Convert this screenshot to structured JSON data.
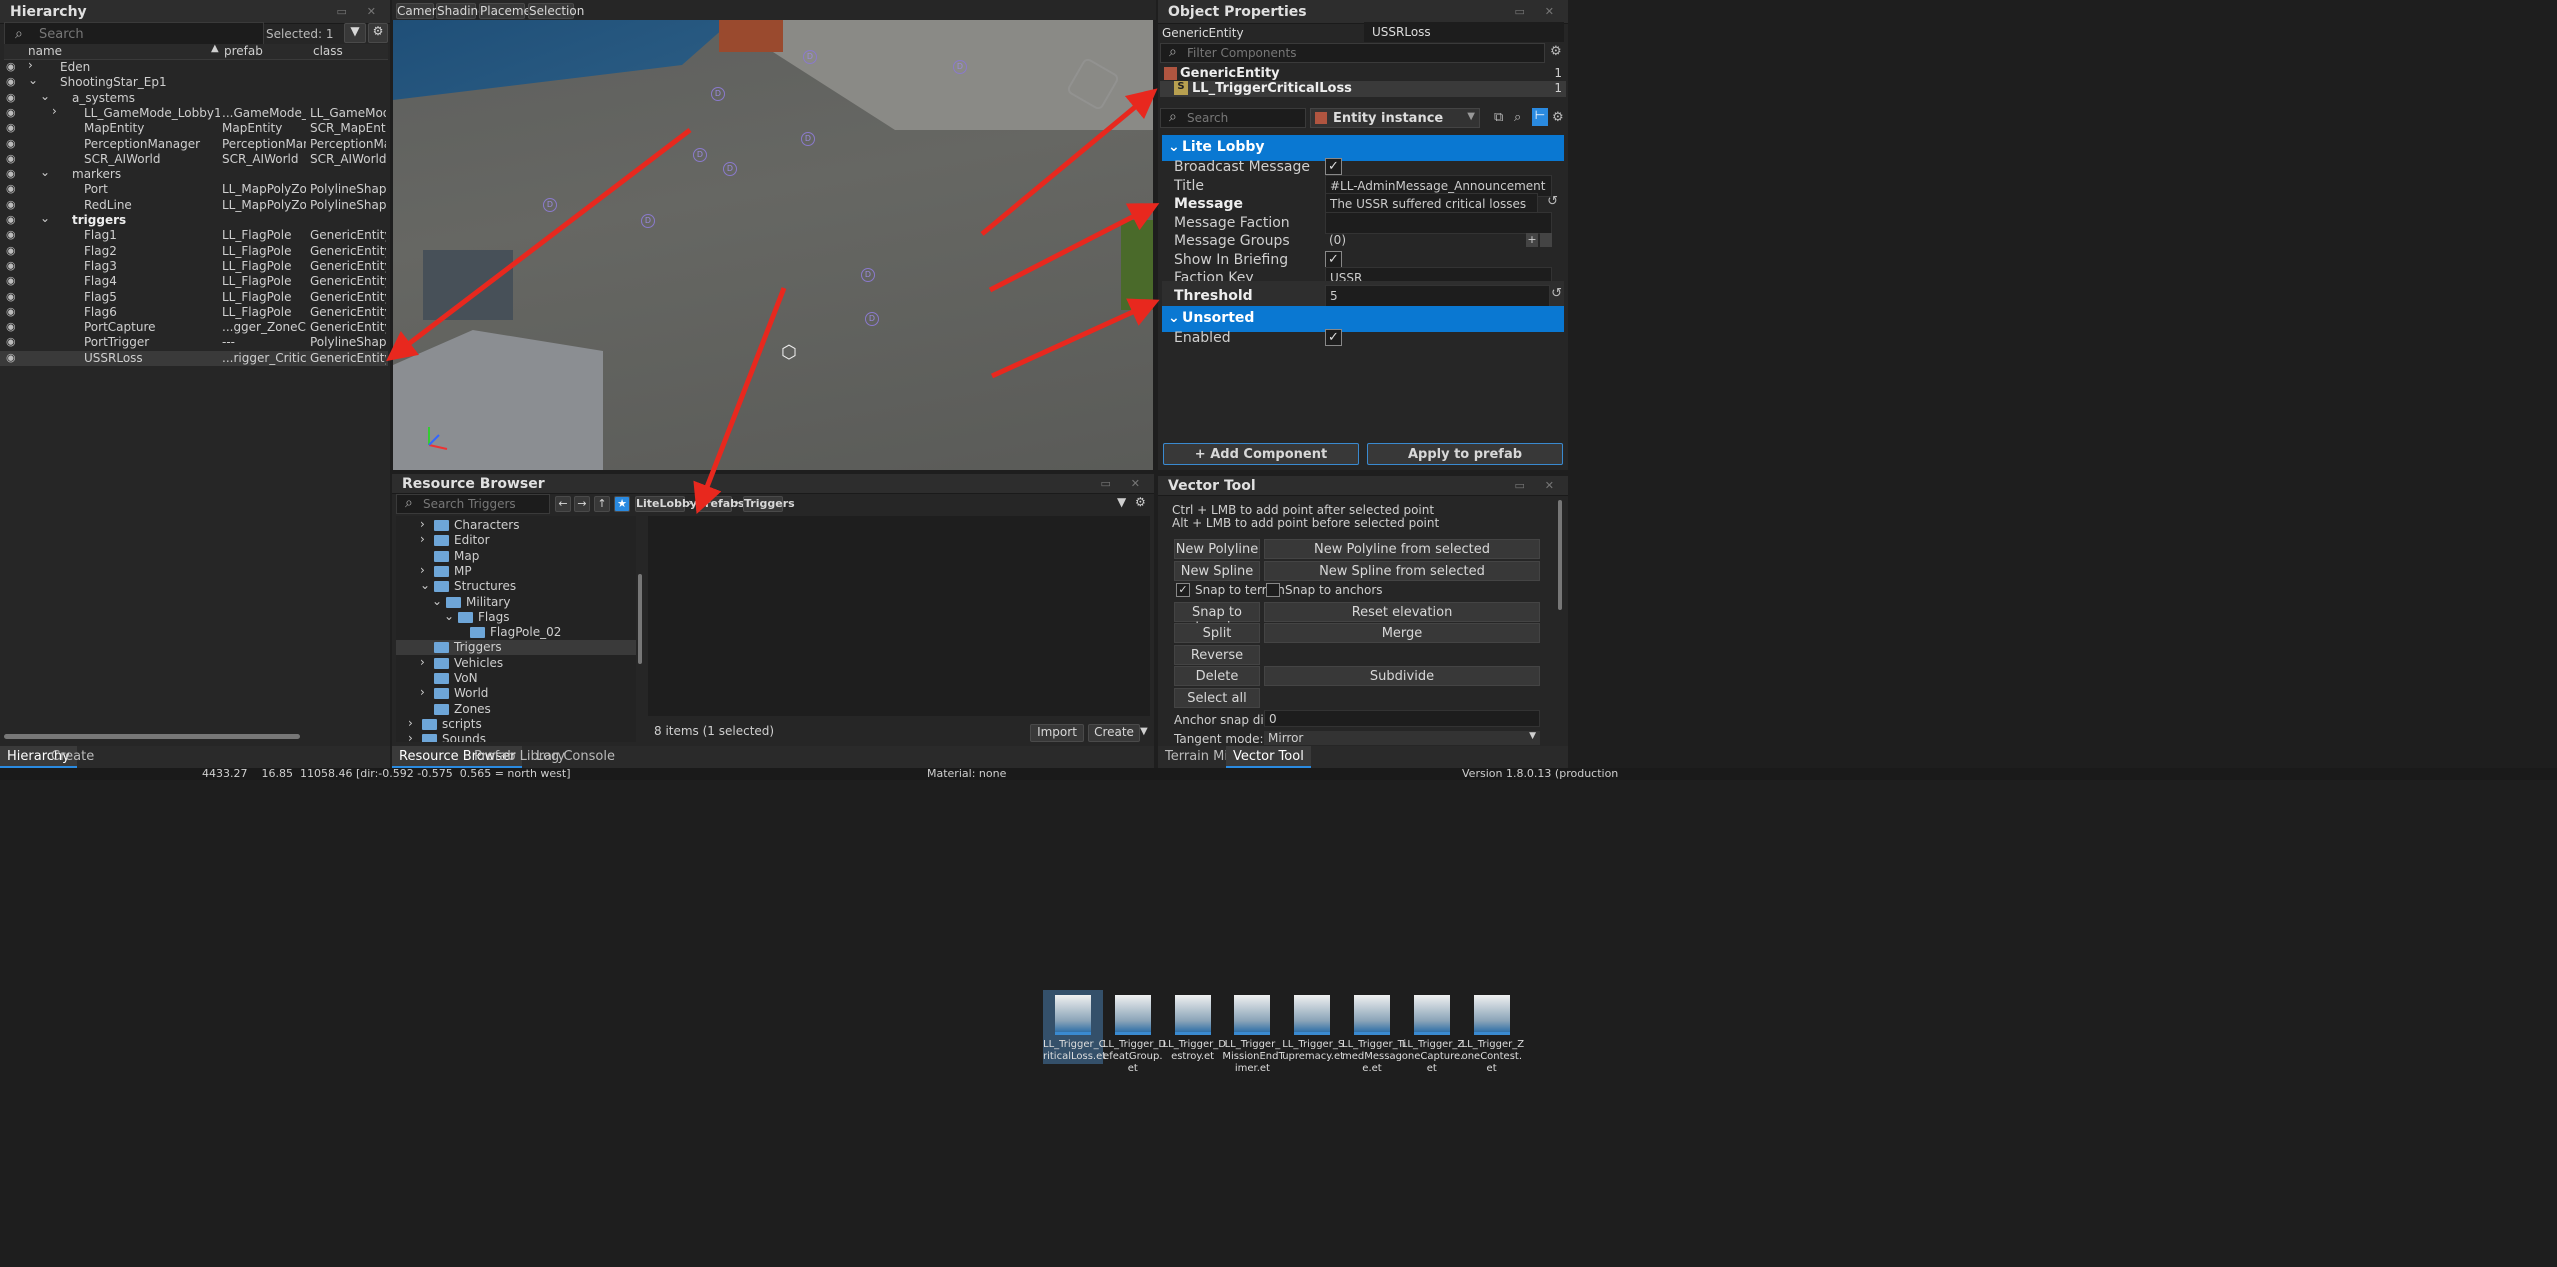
{
  "hierarchy": {
    "title": "Hierarchy",
    "search_placeholder": "Search",
    "selected": "Selected: 1",
    "columns": [
      "name",
      "prefab",
      "class"
    ],
    "rows": [
      {
        "name": "Eden",
        "prefab": "",
        "class": "",
        "depth": 1,
        "icon": "globe-icon",
        "expand": "›"
      },
      {
        "name": "ShootingStar_Ep1",
        "prefab": "",
        "class": "",
        "depth": 1,
        "icon": "globe-icon",
        "expand": "⌄"
      },
      {
        "name": "a_systems",
        "prefab": "",
        "class": "",
        "depth": 2,
        "icon": "layer-icon",
        "expand": "⌄"
      },
      {
        "name": "LL_GameMode_Lobby1",
        "prefab": "...GameMode_Lobby",
        "class": "LL_GameModeCoc",
        "depth": 3,
        "icon": "entity-icon",
        "expand": "›"
      },
      {
        "name": "MapEntity",
        "prefab": "MapEntity",
        "class": "SCR_MapEntity",
        "depth": 3,
        "icon": "entity-icon",
        "expand": ""
      },
      {
        "name": "PerceptionManager",
        "prefab": "PerceptionManager",
        "class": "PerceptionManage",
        "depth": 3,
        "icon": "entity-icon",
        "expand": ""
      },
      {
        "name": "SCR_AIWorld",
        "prefab": "SCR_AIWorld",
        "class": "SCR_AIWorld",
        "depth": 3,
        "icon": "entity-icon",
        "expand": ""
      },
      {
        "name": "markers",
        "prefab": "",
        "class": "",
        "depth": 2,
        "icon": "layer-icon",
        "expand": "⌄"
      },
      {
        "name": "Port",
        "prefab": "LL_MapPolyZone",
        "class": "PolylineShapeEntit",
        "depth": 3,
        "icon": "entity-icon",
        "expand": ""
      },
      {
        "name": "RedLine",
        "prefab": "LL_MapPolyZone",
        "class": "PolylineShapeEntit",
        "depth": 3,
        "icon": "entity-icon",
        "expand": ""
      },
      {
        "name": "triggers",
        "prefab": "",
        "class": "",
        "depth": 2,
        "icon": "layer-icon",
        "expand": "⌄",
        "bold": true
      },
      {
        "name": "Flag1",
        "prefab": "LL_FlagPole",
        "class": "GenericEntity",
        "depth": 3,
        "icon": "entity-icon",
        "expand": ""
      },
      {
        "name": "Flag2",
        "prefab": "LL_FlagPole",
        "class": "GenericEntity",
        "depth": 3,
        "icon": "entity-icon",
        "expand": ""
      },
      {
        "name": "Flag3",
        "prefab": "LL_FlagPole",
        "class": "GenericEntity",
        "depth": 3,
        "icon": "entity-icon",
        "expand": ""
      },
      {
        "name": "Flag4",
        "prefab": "LL_FlagPole",
        "class": "GenericEntity",
        "depth": 3,
        "icon": "entity-icon",
        "expand": ""
      },
      {
        "name": "Flag5",
        "prefab": "LL_FlagPole",
        "class": "GenericEntity",
        "depth": 3,
        "icon": "entity-icon",
        "expand": ""
      },
      {
        "name": "Flag6",
        "prefab": "LL_FlagPole",
        "class": "GenericEntity",
        "depth": 3,
        "icon": "entity-icon",
        "expand": ""
      },
      {
        "name": "PortCapture",
        "prefab": "...gger_ZoneCapture",
        "class": "GenericEntity",
        "depth": 3,
        "icon": "entity-icon",
        "expand": ""
      },
      {
        "name": "PortTrigger",
        "prefab": "---",
        "class": "PolylineShapeEntit",
        "depth": 3,
        "icon": "prefab-cube-icon",
        "expand": ""
      },
      {
        "name": "USSRLoss",
        "prefab": "...rigger_CriticalLoss",
        "class": "GenericEntity",
        "depth": 3,
        "icon": "entity-icon",
        "expand": "",
        "selected": true
      }
    ],
    "bottom_tabs": [
      "Hierarchy",
      "Create"
    ]
  },
  "viewport": {
    "tabs": [
      "Camera",
      "Shading",
      "Placement",
      "Selection"
    ],
    "markers": [
      "D",
      "D",
      "D",
      "D",
      "D",
      "D",
      "D",
      "D",
      "D",
      "D"
    ]
  },
  "object_properties": {
    "title": "Object Properties",
    "entity_class": "GenericEntity",
    "entity_name": "USSRLoss",
    "filter_placeholder": "Filter Components",
    "components": [
      {
        "name": "GenericEntity",
        "count": "1"
      },
      {
        "name": "LL_TriggerCriticalLoss",
        "count": "1",
        "badge": "S"
      }
    ],
    "search_placeholder": "Search",
    "instance_mode": "Entity instance",
    "sections": [
      {
        "title": "Lite Lobby"
      },
      {
        "title": "Unsorted"
      }
    ],
    "props": {
      "broadcast_message": "Broadcast Message",
      "title_label": "Title",
      "title_value": "#LL-AdminMessage_Announcement",
      "message_label": "Message",
      "message_value": "The USSR suffered critical losses",
      "message_faction": "Message Faction",
      "message_groups": "Message Groups",
      "message_groups_value": "(0)",
      "show_in_briefing": "Show In Briefing",
      "faction_key": "Faction Key",
      "faction_key_value": "USSR",
      "threshold": "Threshold",
      "threshold_value": "5",
      "enabled": "Enabled"
    },
    "add_component": "+ Add Component",
    "apply_prefab": "Apply to prefab"
  },
  "resource_browser": {
    "title": "Resource Browser",
    "search_placeholder": "Search Triggers",
    "breadcrumb": [
      "LiteLobby",
      "Prefabs",
      "Triggers"
    ],
    "tree": [
      {
        "label": "Characters",
        "depth": 2,
        "expand": "›"
      },
      {
        "label": "Editor",
        "depth": 2,
        "expand": "›"
      },
      {
        "label": "Map",
        "depth": 2,
        "expand": ""
      },
      {
        "label": "MP",
        "depth": 2,
        "expand": "›"
      },
      {
        "label": "Structures",
        "depth": 2,
        "expand": "⌄"
      },
      {
        "label": "Military",
        "depth": 3,
        "expand": "⌄"
      },
      {
        "label": "Flags",
        "depth": 4,
        "expand": "⌄"
      },
      {
        "label": "FlagPole_02",
        "depth": 5,
        "expand": ""
      },
      {
        "label": "Triggers",
        "depth": 2,
        "expand": "",
        "selected": true
      },
      {
        "label": "Vehicles",
        "depth": 2,
        "expand": "›"
      },
      {
        "label": "VoN",
        "depth": 2,
        "expand": ""
      },
      {
        "label": "World",
        "depth": 2,
        "expand": "›"
      },
      {
        "label": "Zones",
        "depth": 2,
        "expand": ""
      },
      {
        "label": "scripts",
        "depth": 1,
        "expand": "›"
      },
      {
        "label": "Sounds",
        "depth": 1,
        "expand": "›"
      }
    ],
    "assets": [
      {
        "line1": "LL_Trigger_C",
        "line2": "riticalLoss.et",
        "line3": "",
        "selected": true
      },
      {
        "line1": "LL_Trigger_D",
        "line2": "efeatGroup.",
        "line3": "et"
      },
      {
        "line1": "LL_Trigger_D",
        "line2": "estroy.et",
        "line3": ""
      },
      {
        "line1": "LL_Trigger_",
        "line2": "MissionEndT",
        "line3": "imer.et"
      },
      {
        "line1": "LL_Trigger_S",
        "line2": "upremacy.et",
        "line3": ""
      },
      {
        "line1": "LL_Trigger_Ti",
        "line2": "medMessag",
        "line3": "e.et"
      },
      {
        "line1": "LL_Trigger_Z",
        "line2": "oneCapture.",
        "line3": "et"
      },
      {
        "line1": "LL_Trigger_Z",
        "line2": "oneContest.",
        "line3": "et"
      }
    ],
    "item_count": "8 items (1 selected)",
    "import": "Import",
    "create": "Create",
    "bottom_tabs": [
      "Resource Browser",
      "Prefab Library",
      "Log Console"
    ]
  },
  "vector_tool": {
    "title": "Vector Tool",
    "hint1": "Ctrl + LMB to add point after selected point",
    "hint2": "Alt + LMB to add point before selected point",
    "new_polyline": "New Polyline",
    "new_polyline_from": "New Polyline from selected",
    "new_spline": "New Spline",
    "new_spline_from": "New Spline from selected",
    "snap_terrain_chk": "Snap to terrain",
    "snap_anchors_chk": "Snap to anchors",
    "snap_terrain_btn": "Snap to terrain",
    "reset_elevation": "Reset elevation",
    "split": "Split",
    "merge": "Merge",
    "reverse": "Reverse",
    "delete": "Delete",
    "subdivide": "Subdivide",
    "select_all": "Select all",
    "anchor_snap_label": "Anchor snap distance:",
    "anchor_snap_value": "0",
    "tangent_label": "Tangent mode:",
    "tangent_value": "Mirror",
    "bottom_tabs": [
      "Terrain Minimap",
      "Vector Tool"
    ]
  },
  "status_bar": {
    "coords": "4433.27    16.85  11058.46 [dir:-0.592 -0.575  0.565 = north west]",
    "material": "Material: none",
    "version": "Version 1.8.0.13 (production"
  },
  "colors": {
    "accent": "#0a78d2",
    "annotation_arrow": "#e8281e"
  }
}
